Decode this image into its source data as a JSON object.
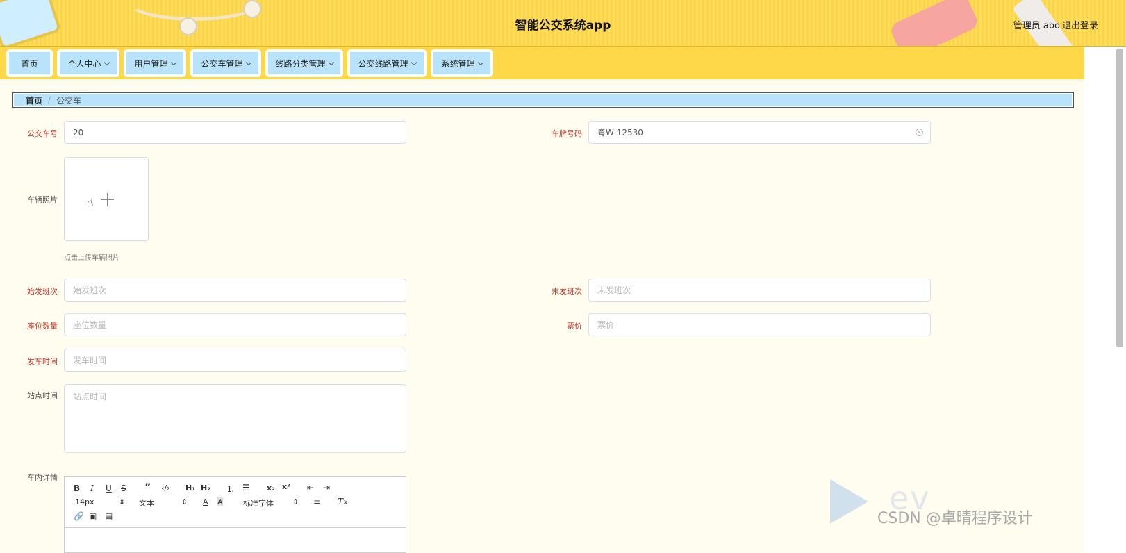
{
  "header": {
    "title": "智能公交系统app",
    "user_label": "管理员 abo",
    "logout_label": "退出登录"
  },
  "nav": {
    "items": [
      {
        "label": "首页",
        "has_dropdown": false
      },
      {
        "label": "个人中心",
        "has_dropdown": true
      },
      {
        "label": "用户管理",
        "has_dropdown": true
      },
      {
        "label": "公交车管理",
        "has_dropdown": true
      },
      {
        "label": "线路分类管理",
        "has_dropdown": true
      },
      {
        "label": "公交线路管理",
        "has_dropdown": true
      },
      {
        "label": "系统管理",
        "has_dropdown": true
      }
    ]
  },
  "breadcrumb": {
    "home": "首页",
    "separator": "/",
    "current": "公交车"
  },
  "form": {
    "bus_no": {
      "label": "公交车号",
      "value": "20"
    },
    "plate": {
      "label": "车牌号码",
      "value": "粤W-12530"
    },
    "photo": {
      "label": "车辆照片",
      "tip": "点击上传车辆照片"
    },
    "first_run": {
      "label": "始发班次",
      "placeholder": "始发班次"
    },
    "last_run": {
      "label": "末发班次",
      "placeholder": "末发班次"
    },
    "seats": {
      "label": "座位数量",
      "placeholder": "座位数量"
    },
    "fare": {
      "label": "票价",
      "placeholder": "票价"
    },
    "depart_time": {
      "label": "发车时间",
      "placeholder": "发车时间"
    },
    "stop_time": {
      "label": "站点时间",
      "placeholder": "站点时间"
    },
    "details": {
      "label": "车内详情"
    }
  },
  "editor": {
    "font_size": "14px",
    "block_type": "文本",
    "font_family": "标准字体"
  },
  "watermark": {
    "csdn": "CSDN @卓晴程序设计"
  },
  "colors": {
    "header_bg": "#ffd84a",
    "nav_item_bg": "#b8e3fa",
    "page_bg": "#fffdf0",
    "required_label": "#c0392b"
  }
}
